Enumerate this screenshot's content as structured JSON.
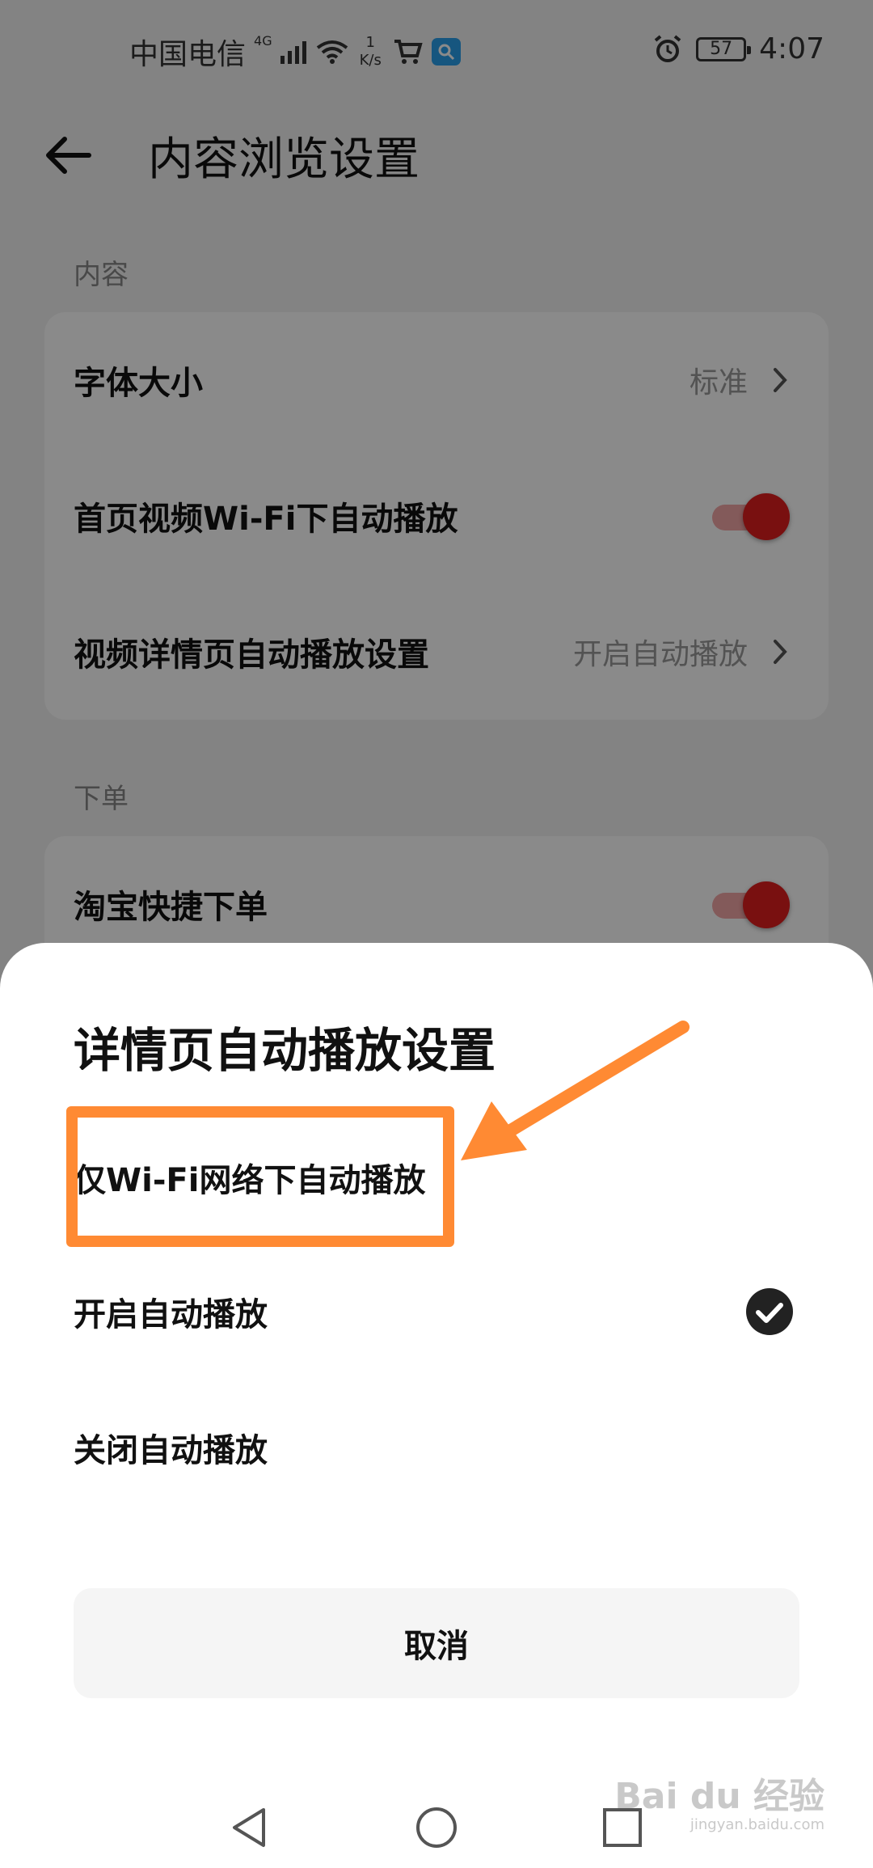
{
  "status_bar": {
    "carrier": "中国电信",
    "network": "4G",
    "speed_value": "1",
    "speed_unit": "K/s",
    "battery": "57",
    "time": "4:07"
  },
  "header": {
    "title": "内容浏览设置"
  },
  "sections": {
    "content_label": "内容",
    "order_label": "下单"
  },
  "content_rows": [
    {
      "label": "字体大小",
      "value": "标准"
    },
    {
      "label": "首页视频Wi-Fi下自动播放",
      "toggle_on": true
    },
    {
      "label": "视频详情页自动播放设置",
      "value": "开启自动播放"
    }
  ],
  "order_rows": [
    {
      "label": "淘宝快捷下单",
      "toggle_on": true
    }
  ],
  "sheet": {
    "title": "详情页自动播放设置",
    "options": [
      {
        "label": "仅Wi-Fi网络下自动播放",
        "selected": false
      },
      {
        "label": "开启自动播放",
        "selected": true
      },
      {
        "label": "关闭自动播放",
        "selected": false
      }
    ],
    "cancel_label": "取消"
  },
  "watermark": {
    "brand": "Bai du 经验",
    "url": "jingyan.baidu.com"
  },
  "colors": {
    "accent_red": "#e01e1e",
    "annotation_orange": "#ff8a33",
    "dim_overlay": "rgba(0,0,0,0.46)"
  },
  "icons": [
    "back-arrow-icon",
    "chevron-right-icon",
    "check-circle-icon",
    "nav-back-icon",
    "nav-home-icon",
    "nav-recents-icon"
  ]
}
